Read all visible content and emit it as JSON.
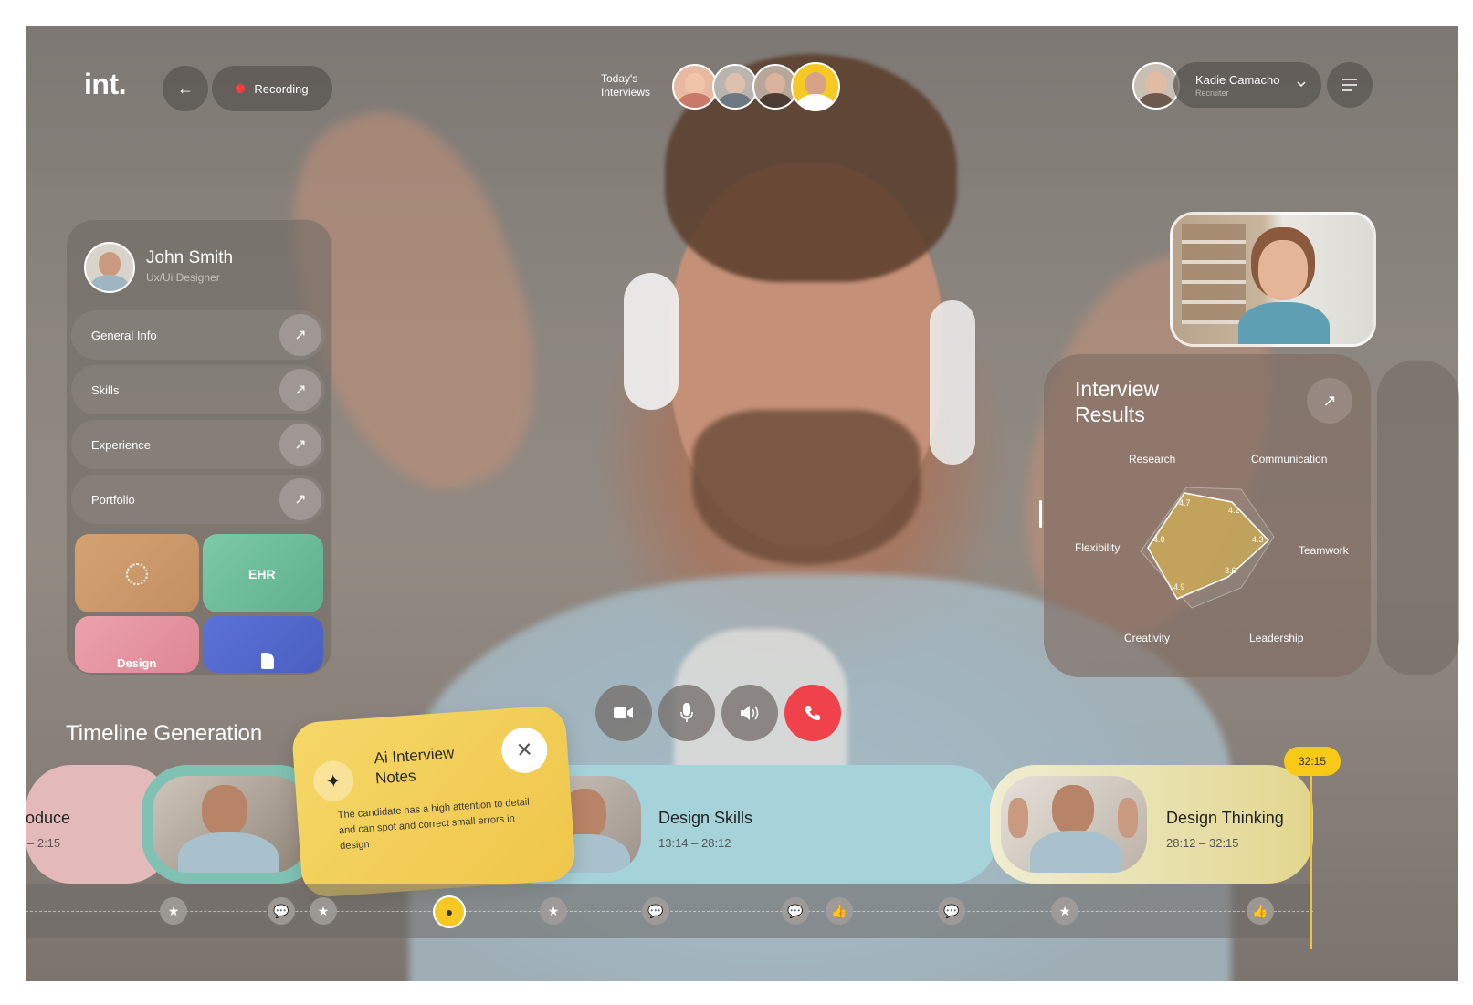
{
  "app": {
    "logo": "int."
  },
  "header": {
    "back_glyph": "←",
    "recording_label": "Recording",
    "today_interviews": [
      "Today's",
      "Interviews"
    ],
    "user_name": "Kadie Camacho",
    "user_role": "Recruiter"
  },
  "profile": {
    "name": "John Smith",
    "role": "Ux/Ui Designer",
    "items": [
      {
        "label": "General Info"
      },
      {
        "label": "Skills"
      },
      {
        "label": "Experience"
      },
      {
        "label": "Portfolio"
      }
    ],
    "portfolio_labels": [
      "EHR",
      "Design"
    ]
  },
  "results": {
    "title_line1": "Interview",
    "title_line2": "Results",
    "axes": [
      "Research",
      "Communication",
      "Teamwork",
      "Leadership",
      "Creativity",
      "Flexibility"
    ],
    "scores": [
      "4.7",
      "4.2",
      "4.3",
      "3.6",
      "4.9",
      "4.8"
    ]
  },
  "timeline": {
    "title": "Timeline Generation",
    "segments": [
      {
        "title": "oduce",
        "time": "– 2:15",
        "color": "#e4b9b9"
      },
      {
        "title": "Design Skills",
        "time": "13:14 – 28:12",
        "color": "#a6d3da"
      },
      {
        "title": "Design Thinking",
        "time": "28:12 – 32:15",
        "color": "#e5dd9e"
      }
    ],
    "current_time": "32:15",
    "markers": [
      "star-icon",
      "chat-icon",
      "star-icon",
      "chat-icon",
      "star-icon",
      "chat-icon",
      "chat-icon",
      "thumbs-up-icon",
      "chat-icon",
      "star-icon",
      "thumbs-up-icon"
    ]
  },
  "notes": {
    "title_line1": "Ai Interview",
    "title_line2": "Notes",
    "body": "The candidate has a high attention to detail and can spot and correct small errors in design"
  },
  "controls": [
    "camera-icon",
    "microphone-icon",
    "speaker-icon",
    "end-call-icon"
  ],
  "colors": {
    "accent_yellow": "#f6c824",
    "end_call_red": "#f0424a",
    "recording_red": "#ff3b3b"
  }
}
